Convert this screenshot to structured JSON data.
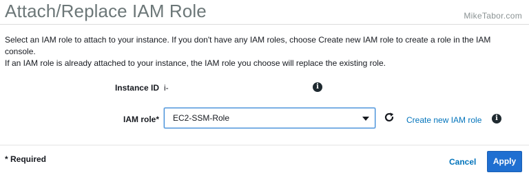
{
  "dialog": {
    "title": "Attach/Replace IAM Role",
    "watermark": "MikeTabor.com",
    "description_line1": "Select an IAM role to attach to your instance. If you don't have any IAM roles, choose Create new IAM role to create a role in the IAM console.",
    "description_line2": "If an IAM role is already attached to your instance, the IAM role you choose will replace the existing role."
  },
  "form": {
    "instance_id_label": "Instance ID",
    "instance_id_value": "i-",
    "iam_role_label": "IAM role*",
    "iam_role_selected": "EC2-SSM-Role",
    "create_role_link": "Create new IAM role",
    "info_icon_glyph": "i",
    "icons": [
      "info-icon",
      "refresh-icon",
      "chevron-down-icon"
    ]
  },
  "footer": {
    "required_note": "* Required",
    "cancel_label": "Cancel",
    "apply_label": "Apply"
  },
  "colors": {
    "title": "#6c7778",
    "link": "#0073bb",
    "primary_button": "#1f6fd1",
    "select_border": "#3b8ad8"
  }
}
